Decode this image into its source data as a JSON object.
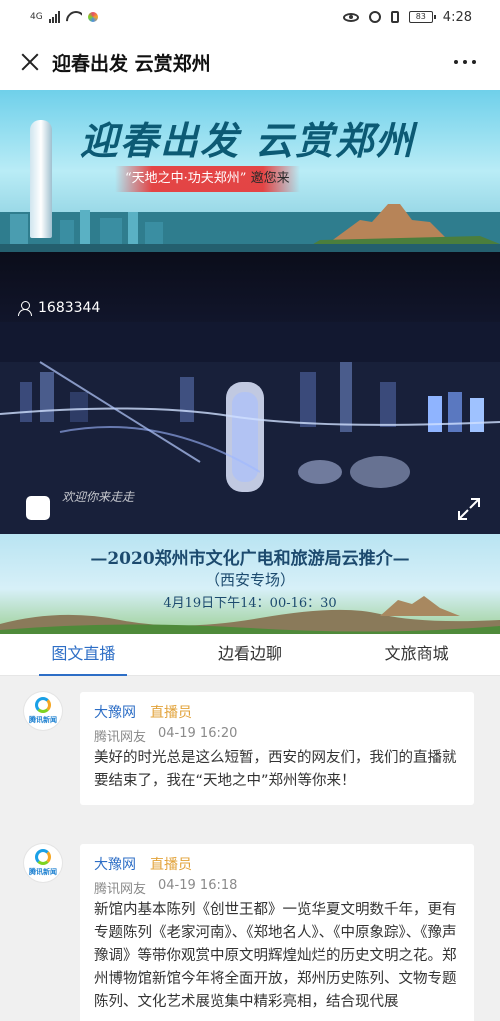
{
  "status_bar": {
    "network": "4G",
    "battery": "83",
    "time": "4:28"
  },
  "header": {
    "title": "迎春出发 云赏郑州"
  },
  "banner": {
    "title": "迎春出发 云赏郑州",
    "subtitle": "“天地之中·功夫郑州”",
    "invite": "邀您来"
  },
  "video": {
    "viewer_count": "1683344",
    "caption": "欢迎你来走走"
  },
  "promo": {
    "line1": "—2020郑州市文化广电和旅游局云推介—",
    "line2": "（西安专场）",
    "line3": "4月19日下午14：00-16：30"
  },
  "tabs": [
    "图文直播",
    "边看边聊",
    "文旅商城"
  ],
  "posts": [
    {
      "avatar_brand": "腾讯新闻",
      "author": "大豫网",
      "role": "直播员",
      "source": "腾讯网友",
      "time": "04-19 16:20",
      "content": "美好的时光总是这么短暂，西安的网友们，我们的直播就要结束了，我在“天地之中”郑州等你来！"
    },
    {
      "avatar_brand": "腾讯新闻",
      "author": "大豫网",
      "role": "直播员",
      "source": "腾讯网友",
      "time": "04-19 16:18",
      "content": "新馆内基本陈列《创世王都》一览华夏文明数千年，更有专题陈列《老家河南》、《郑地名人》、《中原象踪》、《豫声豫调》等带你观赏中原文明辉煌灿烂的历史文明之花。郑州博物馆新馆今年将全面开放，郑州历史陈列、文物专题陈列、文化艺术展览集中精彩亮相，结合现代展"
    }
  ]
}
